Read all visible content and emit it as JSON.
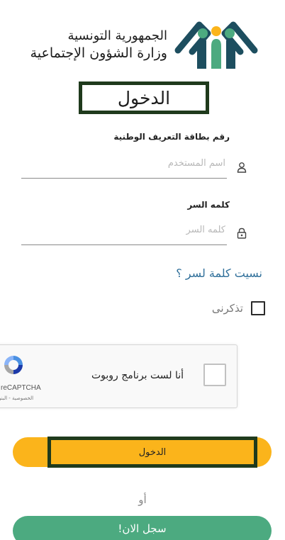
{
  "header": {
    "line1": "الجمهورية التونسية",
    "line2": "وزارة الشؤون الإجتماعية"
  },
  "colors": {
    "brand_dark": "#1f3a1c",
    "logo_navy": "#1d4e5f",
    "logo_teal": "#4caa80",
    "logo_yellow": "#fbb41b",
    "login_button": "#fbb41b",
    "register_button": "#4caa80",
    "link": "#2f6f9a"
  },
  "page_title": "الدخول",
  "form": {
    "id_label": "رقم بطاقة التعريف الوطنية",
    "username_placeholder": "اسم المستخدم",
    "username_icon": "user-icon",
    "password_label": "كلمه السر",
    "password_placeholder": "كلمه السر",
    "password_icon": "lock-icon",
    "forgot_password": "نسيت كلمة لسر ؟",
    "remember_me": "تذكرنى"
  },
  "recaptcha": {
    "label": "أنا لست برنامج روبوت",
    "brand": "reCAPTCHA",
    "privacy": "الخصوصية - البنود",
    "icon": "recaptcha-icon"
  },
  "actions": {
    "login_label": "الدخول",
    "or_label": "أو",
    "register_label": "سجل الان!"
  }
}
